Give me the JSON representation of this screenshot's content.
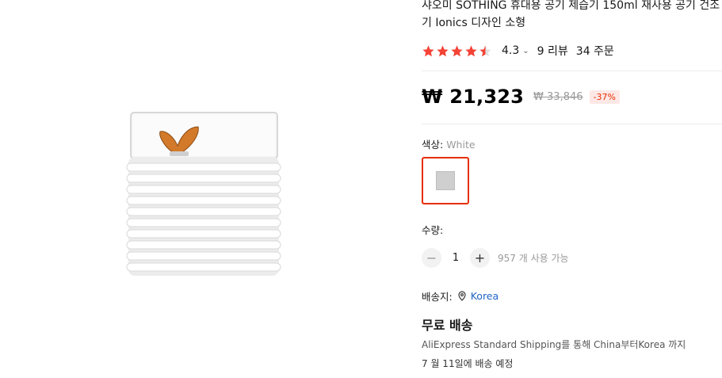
{
  "product": {
    "title": "샤오미 SOTHING 휴대용 공기 제습기 150ml 재사용 공기 건조기 Ionics 디자인 소형",
    "rating": "4.3",
    "reviews": "9 리뷰",
    "orders": "34 주문",
    "price": "₩ 21,323",
    "original_price": "₩ 33,846",
    "discount": "-37%"
  },
  "color": {
    "label": "색상: ",
    "value": "White"
  },
  "quantity": {
    "label": "수량:",
    "value": "1",
    "available": "957 개 사용 가능",
    "minus": "−",
    "plus": "+"
  },
  "shipping": {
    "to_label": "배송지:",
    "country": "Korea",
    "free": "무료 배송",
    "method": "AliExpress Standard Shipping를 통해 China부터Korea 까지",
    "date": "7 월 11일에 배송 예정"
  },
  "icons": {
    "rating_expand": "chevron-down-icon",
    "location": "location-pin-icon"
  },
  "colors": {
    "accent": "#e62e04",
    "link": "#2064c4",
    "star": "#f44336"
  }
}
